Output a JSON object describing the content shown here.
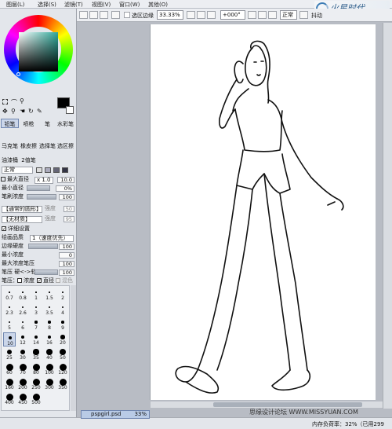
{
  "menubar": {
    "items": [
      {
        "label": "图层(L)"
      },
      {
        "label": "选择(S)"
      },
      {
        "label": "滤镜(T)"
      },
      {
        "label": "视图(V)"
      },
      {
        "label": "窗口(W)"
      },
      {
        "label": "其他(O)"
      }
    ],
    "logo": "火星时代"
  },
  "toolbar": {
    "selection_edge_label": "选区边缘",
    "zoom": "33.33%",
    "rotation": "+000°",
    "mode": "正常",
    "stabilizer_label": "抖动"
  },
  "colors": {
    "accent": "#6f86b0",
    "canvas_bg": "#b8bcc4",
    "paper": "#ffffff"
  },
  "tools": {
    "row1": [
      "铅笔",
      "喷枪",
      "笔",
      "水彩笔"
    ],
    "row2": [
      "马克笔",
      "橡皮擦",
      "选择笔",
      "选区擦"
    ],
    "row3": [
      "油漆桶",
      "2值笔"
    ]
  },
  "brush_settings": {
    "blend_mode": "正常",
    "max_size_label": "最大直径",
    "max_size_multiplier": "x 1.0",
    "max_size_value": "10.0",
    "min_size_label": "最小直径",
    "min_size_value": "0%",
    "density_label": "笔刷浓度",
    "density_value": "100",
    "shape_label": "【通常的圆形】",
    "shape_strength_label": "强度",
    "shape_strength_value": "50",
    "texture_label": "【无材质】",
    "texture_strength_label": "强度",
    "texture_strength_value": "95",
    "detail_label": "详细设置",
    "quality_label": "绘画品质",
    "quality_value": "1（速度优先）",
    "edge_hardness_label": "边缘硬度",
    "edge_hardness_value": "100",
    "min_density_label": "最小浓度",
    "min_density_value": "0",
    "max_density_pressure_label": "最大浓度笔压",
    "max_density_pressure_value": "100",
    "pressure_hardness_label": "笔压 硬<->软",
    "pressure_hardness_value": "100",
    "pressure_label": "笔压：",
    "pressure_opts": [
      "浓度",
      "直径",
      "混色"
    ]
  },
  "brush_sizes": [
    [
      "0.7",
      "0.8",
      "1",
      "1.5",
      "2"
    ],
    [
      "2.3",
      "2.6",
      "3",
      "3.5",
      "4"
    ],
    [
      "5",
      "6",
      "7",
      "8",
      "9"
    ],
    [
      "10",
      "12",
      "14",
      "16",
      "20"
    ],
    [
      "25",
      "30",
      "35",
      "40",
      "50"
    ],
    [
      "60",
      "70",
      "80",
      "100",
      "120"
    ],
    [
      "160",
      "200",
      "250",
      "300",
      "350"
    ],
    [
      "400",
      "450",
      "500"
    ]
  ],
  "document": {
    "tab_name": "pspgirl.psd",
    "tab_zoom": "33%"
  },
  "status": {
    "left": "内存负荷率：32%（已用299",
    "watermark": "思缘设计论坛 WWW.MISSYUAN.COM"
  }
}
